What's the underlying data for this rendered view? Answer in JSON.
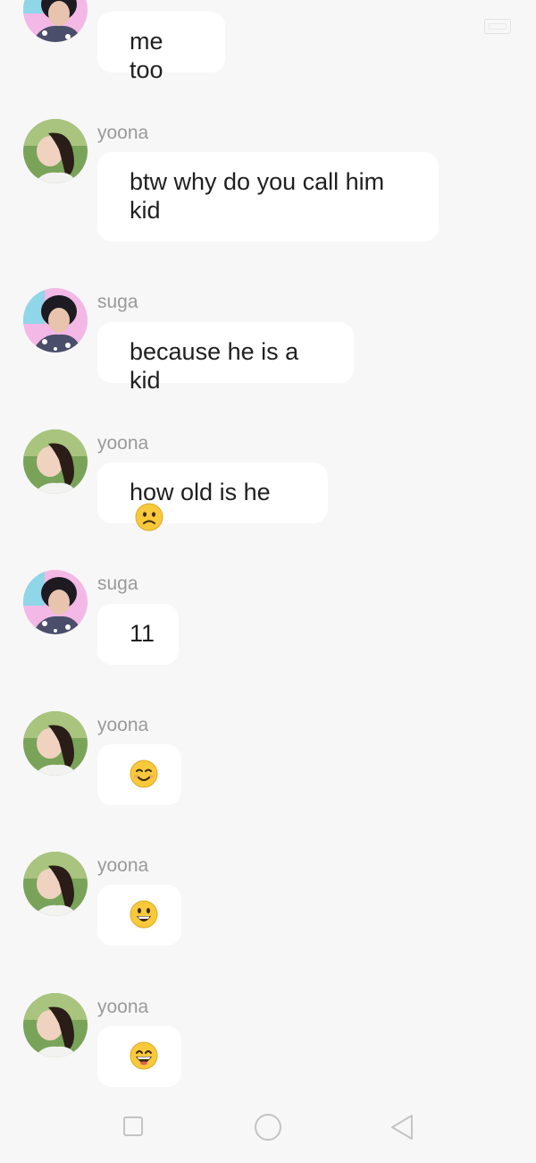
{
  "status_bar": {
    "icon": "battery-icon"
  },
  "messages": [
    {
      "sender": "",
      "avatar": "suga-avatar",
      "text": "me too"
    },
    {
      "sender": "yoona",
      "avatar": "yoona-avatar",
      "text": "btw  why do you call him kid"
    },
    {
      "sender": "suga",
      "avatar": "suga-avatar",
      "text": "because he is a kid"
    },
    {
      "sender": "yoona",
      "avatar": "yoona-avatar",
      "text": "how old is he",
      "emoji": "🙁",
      "emoji_name": "slightly-frowning-face-emoji"
    },
    {
      "sender": "suga",
      "avatar": "suga-avatar",
      "text": "11"
    },
    {
      "sender": "yoona",
      "avatar": "yoona-avatar",
      "text": "",
      "emoji": "😊",
      "emoji_name": "smiling-face-emoji"
    },
    {
      "sender": "yoona",
      "avatar": "yoona-avatar",
      "text": "",
      "emoji": "😀",
      "emoji_name": "grinning-face-emoji"
    },
    {
      "sender": "yoona",
      "avatar": "yoona-avatar",
      "text": "",
      "emoji": "😄",
      "emoji_name": "grinning-smiling-eyes-emoji"
    }
  ],
  "navbar": {
    "recents": "square-icon",
    "home": "circle-icon",
    "back": "back-triangle-icon"
  },
  "colors": {
    "background": "#f7f7f7",
    "bubble": "#ffffff",
    "sender_text": "#9a9a9a",
    "message_text": "#1f1f1f",
    "emoji_yellow": "#f7c93b"
  }
}
